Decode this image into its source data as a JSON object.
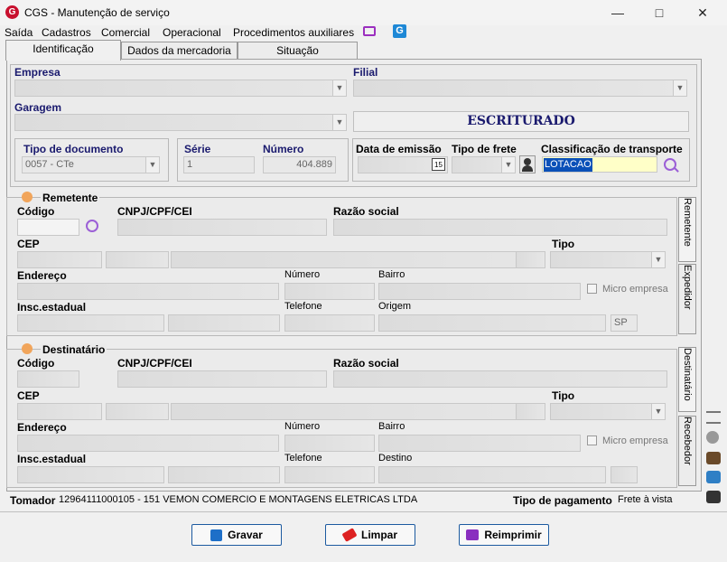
{
  "window": {
    "title": "CGS - Manutenção de serviço"
  },
  "menu": [
    "Saída",
    "Cadastros",
    "Comercial",
    "Operacional",
    "Procedimentos auxiliares"
  ],
  "tabs": [
    "Identificação",
    "Dados da mercadoria",
    "Situação"
  ],
  "identificacao": {
    "empresa_label": "Empresa",
    "filial_label": "Filial",
    "garagem_label": "Garagem",
    "status": "ESCRITURADO",
    "tipo_documento_label": "Tipo de documento",
    "tipo_documento_value": "0057 - CTe",
    "serie_label": "Série",
    "serie_value": "1",
    "numero_label": "Número",
    "numero_value": "404.889",
    "data_emissao_label": "Data de emissão",
    "tipo_frete_label": "Tipo de frete",
    "classificacao_label": "Classificação de transporte",
    "classificacao_value": "LOTACAO"
  },
  "remetente": {
    "title": "Remetente",
    "codigo_label": "Código",
    "cnpj_label": "CNPJ/CPF/CEI",
    "razao_label": "Razão social",
    "cep_label": "CEP",
    "tipo_label": "Tipo",
    "endereco_label": "Endereço",
    "numero_label": "Número",
    "bairro_label": "Bairro",
    "micro_label": "Micro empresa",
    "insc_label": "Insc.estadual",
    "telefone_label": "Telefone",
    "origem_label": "Origem",
    "uf_value": "SP"
  },
  "destinatario": {
    "title": "Destinatário",
    "codigo_label": "Código",
    "cnpj_label": "CNPJ/CPF/CEI",
    "razao_label": "Razão social",
    "cep_label": "CEP",
    "tipo_label": "Tipo",
    "endereco_label": "Endereço",
    "numero_label": "Número",
    "bairro_label": "Bairro",
    "micro_label": "Micro empresa",
    "insc_label": "Insc.estadual",
    "telefone_label": "Telefone",
    "destino_label": "Destino"
  },
  "side_tabs": [
    "Remetente",
    "Expedidor",
    "Destinatário",
    "Recebedor"
  ],
  "footer": {
    "tomador_label": "Tomador",
    "tomador_value": "12964111000105 - 151 VEMON COMERCIO E MONTAGENS ELETRICAS LTDA",
    "tipo_pagamento_label": "Tipo de pagamento",
    "tipo_pagamento_value": "Frete à vista"
  },
  "buttons": {
    "gravar": "Gravar",
    "limpar": "Limpar",
    "reimprimir": "Reimprimir"
  },
  "colors": {
    "accent": "#1c5aa0",
    "title_blue": "#1a1a6e",
    "highlight": "#ffffc8",
    "logo": "#c8102e"
  }
}
